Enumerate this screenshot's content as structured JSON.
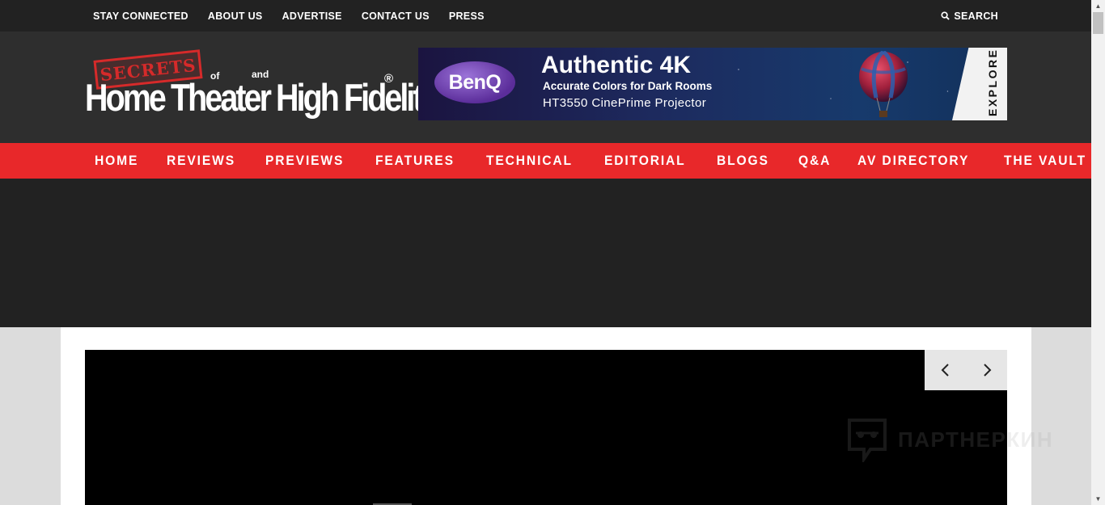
{
  "topbar": {
    "links": [
      "STAY CONNECTED",
      "ABOUT US",
      "ADVERTISE",
      "CONTACT US",
      "PRESS"
    ],
    "search_label": "SEARCH"
  },
  "logo": {
    "stamp": "SECRETS",
    "of": "of",
    "and": "and",
    "main": "Home Theater High Fidelity",
    "registered": "®"
  },
  "ad": {
    "brand": "BenQ",
    "headline": "Authentic 4K",
    "subhead": "Accurate Colors for Dark Rooms",
    "product": "HT3550 CinePrime Projector",
    "cta": "EXPLORE"
  },
  "mainnav": {
    "items": [
      "HOME",
      "REVIEWS",
      "PREVIEWS",
      "FEATURES",
      "TECHNICAL",
      "EDITORIAL",
      "BLOGS",
      "Q&A",
      "AV DIRECTORY",
      "THE VAULT"
    ]
  },
  "watermark": {
    "text": "ПАРТНЕРКИН"
  },
  "colors": {
    "topbar": "#222222",
    "header": "#2e2e2e",
    "nav": "#e8282a",
    "stamp": "#d62a2a"
  }
}
